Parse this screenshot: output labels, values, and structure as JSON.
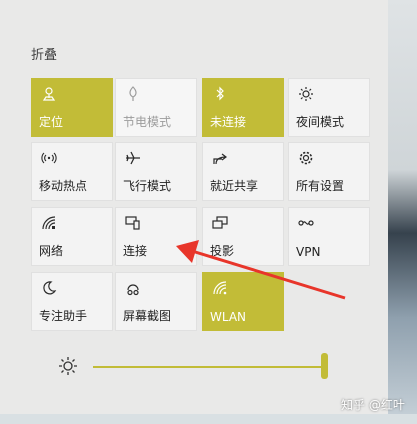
{
  "section": {
    "title": "折叠"
  },
  "tiles": [
    {
      "label": "定位",
      "icon": "location-icon"
    },
    {
      "label": "节电模式",
      "icon": "battery-saver-icon"
    },
    {
      "label": "未连接",
      "icon": "bluetooth-icon"
    },
    {
      "label": "夜间模式",
      "icon": "night-light-icon"
    },
    {
      "label": "移动热点",
      "icon": "hotspot-icon"
    },
    {
      "label": "飞行模式",
      "icon": "airplane-icon"
    },
    {
      "label": "就近共享",
      "icon": "share-icon"
    },
    {
      "label": "所有设置",
      "icon": "gear-icon"
    },
    {
      "label": "网络",
      "icon": "network-icon"
    },
    {
      "label": "连接",
      "icon": "connect-icon"
    },
    {
      "label": "投影",
      "icon": "project-icon"
    },
    {
      "label": "VPN",
      "icon": "vpn-icon"
    },
    {
      "label": "专注助手",
      "icon": "moon-icon"
    },
    {
      "label": "屏幕截图",
      "icon": "screen-snip-icon"
    },
    {
      "label": "WLAN",
      "icon": "wifi-icon"
    }
  ],
  "brightness": {
    "level": 1.0,
    "icon": "sun-icon"
  },
  "watermark": "知乎 @红叶",
  "colors": {
    "accent": "#c2bc37",
    "arrow": "#e8352a",
    "panel": "#e9e9e8"
  }
}
